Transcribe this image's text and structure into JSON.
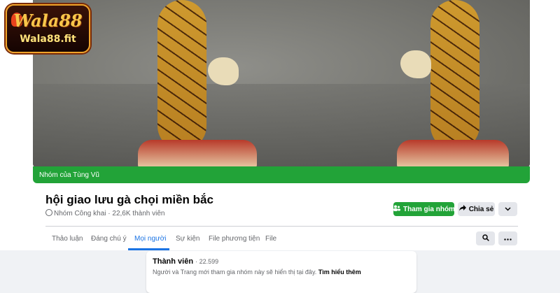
{
  "logo": {
    "brand": "Wala88",
    "domain": "Wala88.fit"
  },
  "cover": {
    "group_owner": "Nhóm của Tùng Vũ"
  },
  "group": {
    "title": "hội giao lưu gà chọi miền bắc",
    "privacy": "Nhóm Công khai",
    "separator": "·",
    "members": "22,6K thành viên"
  },
  "actions": {
    "join": "Tham gia nhóm",
    "share": "Chia sẻ",
    "more_icon": "chevron-down-icon"
  },
  "tabs": [
    {
      "label": "Thảo luận"
    },
    {
      "label": "Đáng chú ý"
    },
    {
      "label": "Mọi người",
      "active": true
    },
    {
      "label": "Sự kiện"
    },
    {
      "label": "File phương tiện"
    },
    {
      "label": "File"
    }
  ],
  "members_card": {
    "title": "Thành viên",
    "count": "· 22.599",
    "description": "Người và Trang mới tham gia nhóm này sẽ hiển thị tại đây.",
    "link": "Tìm hiểu thêm"
  },
  "colors": {
    "accent_green": "#22a338",
    "tab_active": "#1b74e4"
  }
}
